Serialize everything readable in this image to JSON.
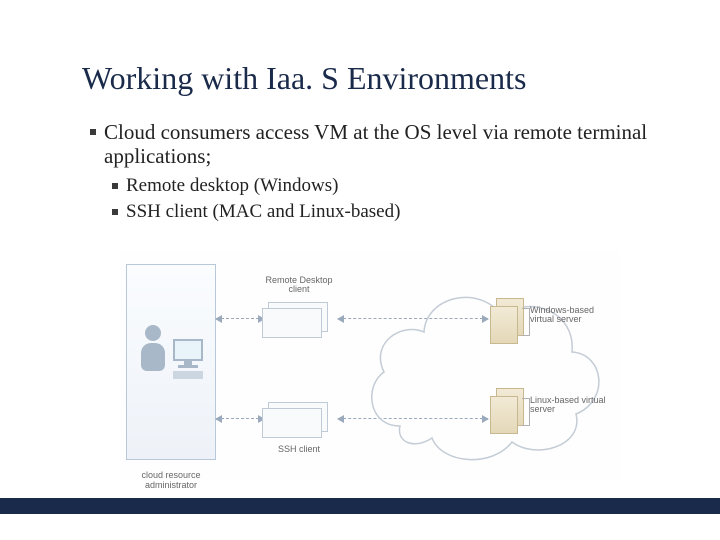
{
  "slide": {
    "title": "Working with Iaa. S Environments",
    "bullets": {
      "main": "Cloud consumers access VM at the OS level via remote terminal applications;",
      "sub1": "Remote desktop (Windows)",
      "sub2": "SSH client (MAC and Linux-based)"
    }
  },
  "diagram": {
    "admin_label": "cloud resource administrator",
    "rdp_label": "Remote Desktop client",
    "ssh_label": "SSH client",
    "win_vs_label": "Windows-based virtual server",
    "lin_vs_label": "Linux-based virtual server"
  }
}
